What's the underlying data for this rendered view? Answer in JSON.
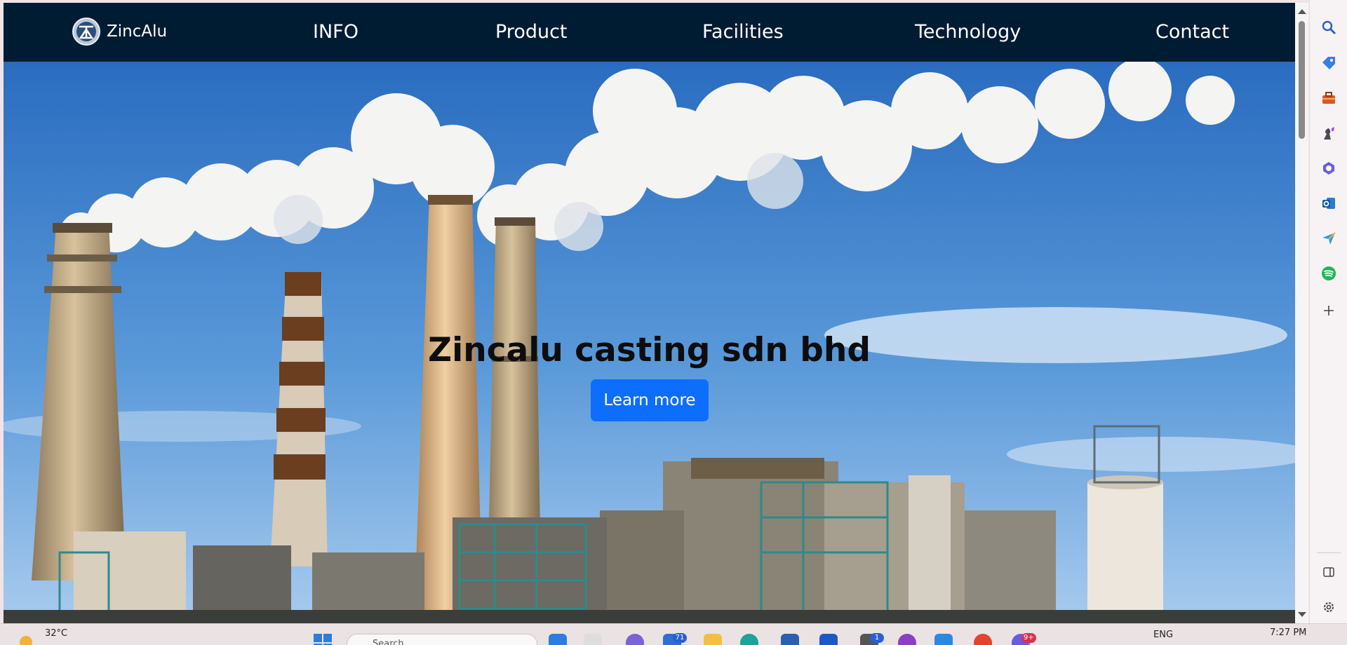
{
  "brand": {
    "name": "ZincAlu",
    "logo_icon": "zincalu-logo-icon"
  },
  "nav": {
    "items": [
      {
        "label": "INFO"
      },
      {
        "label": "Product"
      },
      {
        "label": "Facilities"
      },
      {
        "label": "Technology"
      },
      {
        "label": "Contact"
      }
    ]
  },
  "hero": {
    "title": "Zincalu casting sdn bhd",
    "button_label": "Learn more",
    "image_icon": "industrial-smokestacks-image"
  },
  "colors": {
    "navbar": "#001c33",
    "button": "#0d6efd",
    "sky": "#3f86d4"
  },
  "sidebar": {
    "icons": [
      "search-icon",
      "tag-icon",
      "toolbox-icon",
      "chess-icon",
      "copilot-icon",
      "outlook-icon",
      "send-icon",
      "spotify-icon",
      "add-icon",
      "split-view-icon",
      "settings-icon"
    ]
  },
  "taskbar": {
    "weather": "32°C",
    "search_placeholder": "Search",
    "badges": {
      "mail": "71",
      "app": "1",
      "chat": "9+"
    },
    "language": "ENG",
    "time": "7:27 PM"
  }
}
